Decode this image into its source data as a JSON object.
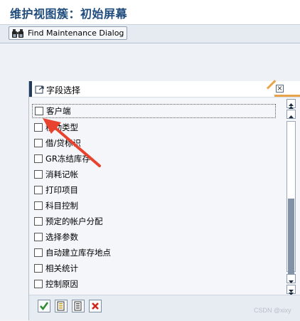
{
  "window": {
    "title": "维护视图簇：初始屏幕"
  },
  "toolbar": {
    "find_maintenance_dialog": "Find Maintenance Dialog"
  },
  "dialog": {
    "title": "字段选择",
    "items": [
      {
        "label": "客户端",
        "checked": false
      },
      {
        "label": "移动类型",
        "checked": false
      },
      {
        "label": "借/贷标识",
        "checked": false
      },
      {
        "label": "GR冻结库存",
        "checked": false
      },
      {
        "label": "消耗记帐",
        "checked": false
      },
      {
        "label": "打印项目",
        "checked": false
      },
      {
        "label": "科目控制",
        "checked": false
      },
      {
        "label": "预定的帐户分配",
        "checked": false
      },
      {
        "label": "选择参数",
        "checked": false
      },
      {
        "label": "自动建立库存地点",
        "checked": false
      },
      {
        "label": "相关统计",
        "checked": false
      },
      {
        "label": "控制原因",
        "checked": false
      }
    ],
    "footer_buttons": [
      "confirm-icon",
      "select-all-icon",
      "deselect-all-icon",
      "cancel-icon"
    ]
  },
  "watermark": "CSDN @xixy",
  "colors": {
    "title": "#1f4b7d",
    "accent_orange": "#e8a44c",
    "header_dark": "#213b5c",
    "annotation_red": "#e8432e"
  }
}
